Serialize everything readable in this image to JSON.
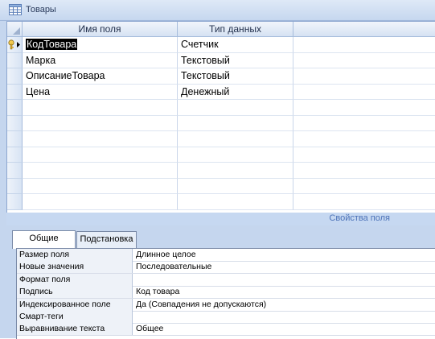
{
  "window": {
    "title": "Товары"
  },
  "grid": {
    "columns": [
      "Имя поля",
      "Тип данных",
      ""
    ],
    "rows": [
      {
        "name": "КодТовара",
        "type": "Счетчик",
        "desc": "",
        "key": true,
        "selected": true
      },
      {
        "name": "Марка",
        "type": "Текстовый",
        "desc": ""
      },
      {
        "name": "ОписаниеТовара",
        "type": "Текстовый",
        "desc": ""
      },
      {
        "name": "Цена",
        "type": "Денежный",
        "desc": ""
      }
    ],
    "empty_rows": 7
  },
  "properties": {
    "title": "Свойства поля",
    "tabs": [
      "Общие",
      "Подстановка"
    ],
    "active_tab": "Общие",
    "rows": [
      {
        "label": "Размер поля",
        "value": "Длинное целое"
      },
      {
        "label": "Новые значения",
        "value": "Последовательные"
      },
      {
        "label": "Формат поля",
        "value": ""
      },
      {
        "label": "Подпись",
        "value": "Код товара"
      },
      {
        "label": "Индексированное поле",
        "value": "Да (Совпадения не допускаются)"
      },
      {
        "label": "Смарт-теги",
        "value": ""
      },
      {
        "label": "Выравнивание текста",
        "value": "Общее"
      }
    ]
  },
  "icons": {
    "table": "table-icon",
    "key": "primary-key-icon",
    "current_row": "row-pointer-icon"
  }
}
